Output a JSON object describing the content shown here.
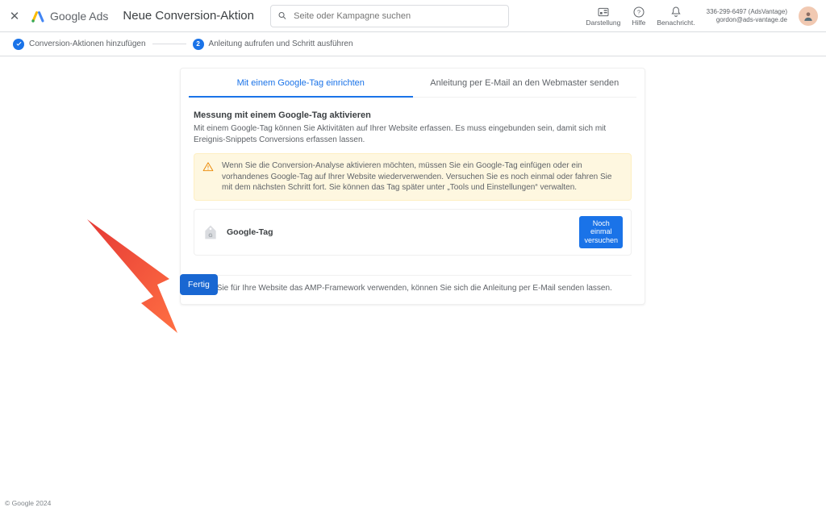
{
  "header": {
    "product": "Google Ads",
    "page_title": "Neue Conversion-Aktion",
    "search_placeholder": "Seite oder Kampagne suchen",
    "icons": {
      "appearance_label": "Darstellung",
      "help_label": "Hilfe",
      "notifications_label": "Benachricht."
    },
    "account": {
      "line1": "336-299-6497 (AdsVantage)",
      "line2": "gordon@ads-vantage.de"
    }
  },
  "steps": {
    "step1_label": "Conversion-Aktionen hinzufügen",
    "step2_number": "2",
    "step2_label": "Anleitung aufrufen und Schritt ausführen"
  },
  "card": {
    "tab1": "Mit einem Google-Tag einrichten",
    "tab2": "Anleitung per E-Mail an den Webmaster senden",
    "heading": "Messung mit einem Google-Tag aktivieren",
    "intro": "Mit einem Google-Tag können Sie Aktivitäten auf Ihrer Website erfassen. Es muss eingebunden sein, damit sich mit Ereignis-Snippets Conversions erfassen lassen.",
    "alert": "Wenn Sie die Conversion-Analyse aktivieren möchten, müssen Sie ein Google-Tag einfügen oder ein vorhandenes Google-Tag auf Ihrer Website wiederverwenden. Versuchen Sie es noch einmal oder fahren Sie mit dem nächsten Schritt fort. Sie können das Tag später unter „Tools und Einstellungen“ verwalten.",
    "tag_name": "Google-Tag",
    "retry_label": "Noch\neinmal\nversuchen",
    "footer_note": "Wenn Sie für Ihre Website das AMP-Framework verwenden, können Sie sich die Anleitung per E-Mail senden lassen."
  },
  "done_label": "Fertig",
  "copyright": "© Google 2024"
}
